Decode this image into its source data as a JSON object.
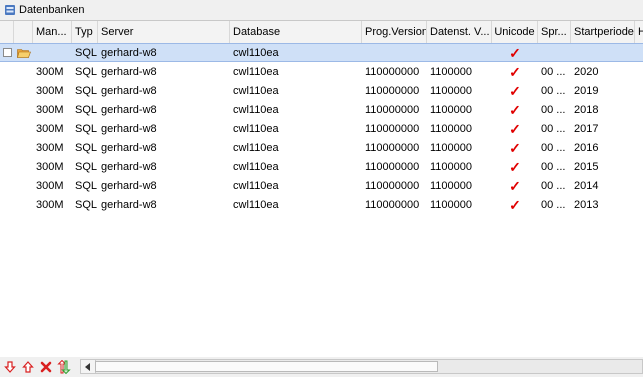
{
  "window": {
    "title": "Datenbanken"
  },
  "columns": {
    "man": "Man...",
    "typ": "Typ",
    "server": "Server",
    "database": "Database",
    "prog": "Prog.Version",
    "dat": "Datenst. V...",
    "unicode": "Unicode",
    "spr": "Spr...",
    "start": "Startperiode",
    "h": "H"
  },
  "selected_row": {
    "typ": "SQL",
    "server": "gerhard-w8",
    "database": "cwl110ea",
    "unicode": "✓"
  },
  "rows": [
    {
      "man": "300M",
      "typ": "SQL",
      "server": "gerhard-w8",
      "database": "cwl110ea",
      "prog": "110000000",
      "dat": "1100000",
      "unicode": "✓",
      "spr": "00 ...",
      "start": "2020"
    },
    {
      "man": "300M",
      "typ": "SQL",
      "server": "gerhard-w8",
      "database": "cwl110ea",
      "prog": "110000000",
      "dat": "1100000",
      "unicode": "✓",
      "spr": "00 ...",
      "start": "2019"
    },
    {
      "man": "300M",
      "typ": "SQL",
      "server": "gerhard-w8",
      "database": "cwl110ea",
      "prog": "110000000",
      "dat": "1100000",
      "unicode": "✓",
      "spr": "00 ...",
      "start": "2018"
    },
    {
      "man": "300M",
      "typ": "SQL",
      "server": "gerhard-w8",
      "database": "cwl110ea",
      "prog": "110000000",
      "dat": "1100000",
      "unicode": "✓",
      "spr": "00 ...",
      "start": "2017"
    },
    {
      "man": "300M",
      "typ": "SQL",
      "server": "gerhard-w8",
      "database": "cwl110ea",
      "prog": "110000000",
      "dat": "1100000",
      "unicode": "✓",
      "spr": "00 ...",
      "start": "2016"
    },
    {
      "man": "300M",
      "typ": "SQL",
      "server": "gerhard-w8",
      "database": "cwl110ea",
      "prog": "110000000",
      "dat": "1100000",
      "unicode": "✓",
      "spr": "00 ...",
      "start": "2015"
    },
    {
      "man": "300M",
      "typ": "SQL",
      "server": "gerhard-w8",
      "database": "cwl110ea",
      "prog": "110000000",
      "dat": "1100000",
      "unicode": "✓",
      "spr": "00 ...",
      "start": "2014"
    },
    {
      "man": "300M",
      "typ": "SQL",
      "server": "gerhard-w8",
      "database": "cwl110ea",
      "prog": "110000000",
      "dat": "1100000",
      "unicode": "✓",
      "spr": "00 ...",
      "start": "2013"
    }
  ],
  "toolbar": {
    "icons": [
      "arrow-down-icon",
      "arrow-up-icon",
      "delete-icon",
      "sort-icon"
    ]
  },
  "colors": {
    "check": "#e00000",
    "selection": "#cfe0f7",
    "accent_red": "#d92020",
    "accent_green": "#2f9e2f"
  }
}
